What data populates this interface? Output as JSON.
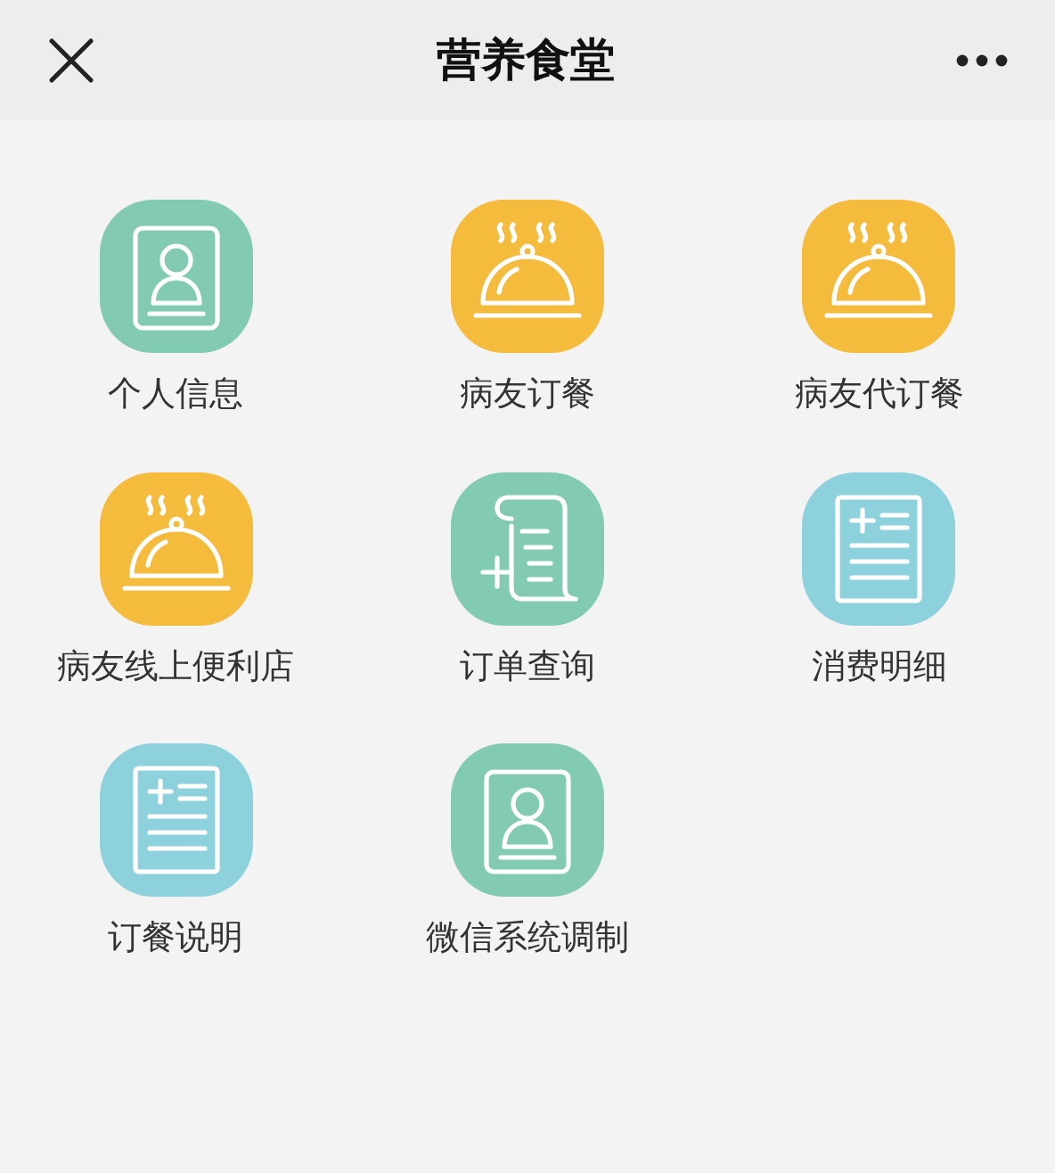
{
  "header": {
    "title": "营养食堂"
  },
  "items": [
    {
      "label": "个人信息",
      "kind": "contact",
      "color": "#82cbb2"
    },
    {
      "label": "病友订餐",
      "kind": "cloche",
      "color": "#f5bb3d"
    },
    {
      "label": "病友代订餐",
      "kind": "cloche",
      "color": "#f5bb3d"
    },
    {
      "label": "病友线上便利店",
      "kind": "cloche",
      "color": "#f5bb3d"
    },
    {
      "label": "订单查询",
      "kind": "scroll",
      "color": "#82cbb2"
    },
    {
      "label": "消费明细",
      "kind": "list",
      "color": "#8dd1dd"
    },
    {
      "label": "订餐说明",
      "kind": "list",
      "color": "#8dd1dd"
    },
    {
      "label": "微信系统调制",
      "kind": "contact",
      "color": "#82cbb2"
    }
  ]
}
